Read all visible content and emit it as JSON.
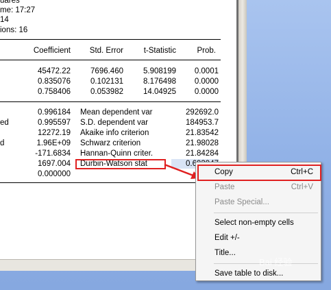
{
  "header": {
    "line_method": "uares",
    "line_time": "me: 17:27",
    "line_sample": "14",
    "line_obs": "ions: 16"
  },
  "table": {
    "columns": [
      "Coefficient",
      "Std. Error",
      "t-Statistic",
      "Prob."
    ],
    "rows": [
      {
        "coef": "45472.22",
        "se": "7696.460",
        "t": "5.908199",
        "p": "0.0001"
      },
      {
        "coef": "0.835076",
        "se": "0.102131",
        "t": "8.176498",
        "p": "0.0000"
      },
      {
        "coef": "0.758406",
        "se": "0.053982",
        "t": "14.04925",
        "p": "0.0000"
      }
    ]
  },
  "stats": [
    {
      "left_label": "",
      "left_value": "0.996184",
      "right_label": "Mean dependent var",
      "right_value": "292692.0"
    },
    {
      "left_label": "ed",
      "left_value": "0.995597",
      "right_label": "S.D. dependent var",
      "right_value": "184953.7"
    },
    {
      "left_label": "",
      "left_value": "12272.19",
      "right_label": "Akaike info criterion",
      "right_value": "21.83542"
    },
    {
      "left_label": "d",
      "left_value": "1.96E+09",
      "right_label": "Schwarz criterion",
      "right_value": "21.98028"
    },
    {
      "left_label": "",
      "left_value": "-171.6834",
      "right_label": "Hannan-Quinn criter.",
      "right_value": "21.84284"
    },
    {
      "left_label": "",
      "left_value": "1697.004",
      "right_label": "Durbin-Watson stat",
      "right_value": "0.693947"
    },
    {
      "left_label": "",
      "left_value": "0.000000",
      "right_label": "",
      "right_value": ""
    }
  ],
  "context_menu": {
    "copy": {
      "label": "Copy",
      "shortcut": "Ctrl+C"
    },
    "paste": {
      "label": "Paste",
      "shortcut": "Ctrl+V"
    },
    "paste_special": {
      "label": "Paste Special..."
    },
    "select_nonempty": {
      "label": "Select non-empty cells"
    },
    "edit": {
      "label": "Edit +/-"
    },
    "title": {
      "label": "Title..."
    },
    "save_table": {
      "label": "Save table to disk..."
    }
  },
  "watermark": "Bai 经验",
  "colors": {
    "highlight": "#e02020",
    "desktop": "#8fb0e6"
  }
}
